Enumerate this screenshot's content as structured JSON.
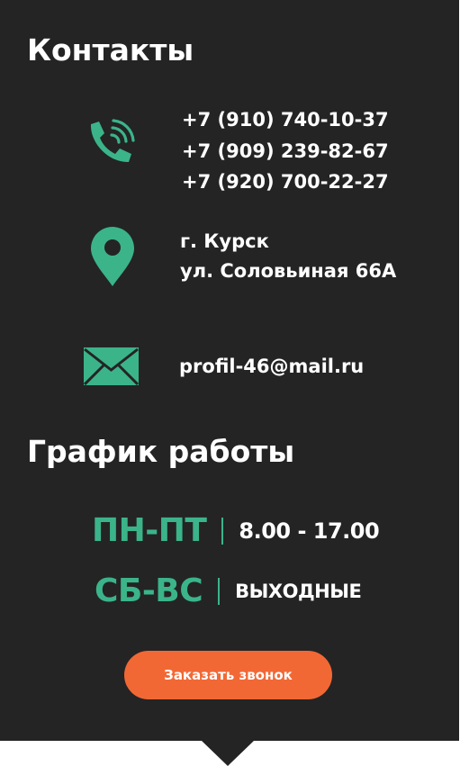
{
  "contacts": {
    "title": "Контакты",
    "phones": [
      "+7 (910) 740-10-37",
      "+7 (909) 239-82-67",
      "+7 (920) 700-22-27"
    ],
    "address": [
      "г. Курск",
      "ул. Соловьиная 66А"
    ],
    "email": "profil-46@mail.ru",
    "icons": {
      "phone": "phone-icon",
      "location": "location-pin-icon",
      "mail": "envelope-icon"
    },
    "accent_color": "#3bb48a"
  },
  "schedule": {
    "title": "График работы",
    "rows": [
      {
        "days": "ПН-ПТ",
        "hours": "8.00 - 17.00"
      },
      {
        "days": "СБ-ВС",
        "hours": "ВЫХОДНЫЕ"
      }
    ]
  },
  "cta": {
    "label": "Заказать звонок",
    "color": "#f26835"
  },
  "panel_color": "#242424"
}
